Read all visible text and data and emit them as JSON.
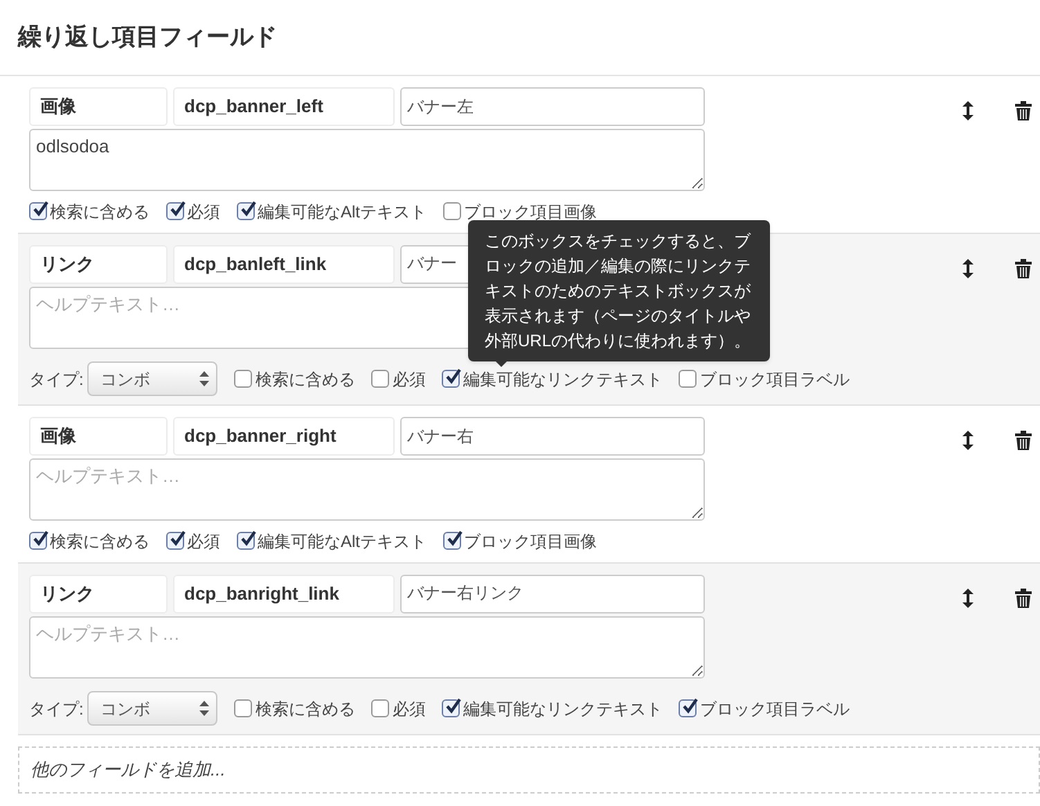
{
  "title": "繰り返し項目フィールド",
  "fields": [
    {
      "kind": "image",
      "type_name": "画像",
      "key": "dcp_banner_left",
      "label": "バナー左",
      "help": {
        "value": "odlsodoa"
      },
      "options": [
        {
          "label": "検索に含める",
          "checked": true
        },
        {
          "label": "必須",
          "checked": true
        },
        {
          "label": "編集可能なAltテキスト",
          "checked": true
        },
        {
          "label": "ブロック項目画像",
          "checked": false
        }
      ]
    },
    {
      "kind": "link",
      "type_name": "リンク",
      "key": "dcp_banleft_link",
      "label": "バナー",
      "help": {
        "placeholder": "ヘルプテキスト…"
      },
      "type_select": {
        "label": "タイプ:",
        "value": "コンボ"
      },
      "options": [
        {
          "label": "検索に含める",
          "checked": false
        },
        {
          "label": "必須",
          "checked": false
        },
        {
          "label": "編集可能なリンクテキスト",
          "checked": true
        },
        {
          "label": "ブロック項目ラベル",
          "checked": false
        }
      ]
    },
    {
      "kind": "image",
      "type_name": "画像",
      "key": "dcp_banner_right",
      "label": "バナー右",
      "help": {
        "placeholder": "ヘルプテキスト…"
      },
      "options": [
        {
          "label": "検索に含める",
          "checked": true
        },
        {
          "label": "必須",
          "checked": true
        },
        {
          "label": "編集可能なAltテキスト",
          "checked": true
        },
        {
          "label": "ブロック項目画像",
          "checked": true
        }
      ]
    },
    {
      "kind": "link",
      "type_name": "リンク",
      "key": "dcp_banright_link",
      "label": "バナー右リンク",
      "help": {
        "placeholder": "ヘルプテキスト…"
      },
      "type_select": {
        "label": "タイプ:",
        "value": "コンボ"
      },
      "options": [
        {
          "label": "検索に含める",
          "checked": false
        },
        {
          "label": "必須",
          "checked": false
        },
        {
          "label": "編集可能なリンクテキスト",
          "checked": true
        },
        {
          "label": "ブロック項目ラベル",
          "checked": true
        }
      ]
    }
  ],
  "tooltip": "このボックスをチェックすると、ブロックの追加／編集の際にリンクテキストのためのテキストボックスが表示されます（ページのタイトルや外部URLの代わりに使われます）。",
  "add_field": "他のフィールドを追加..."
}
